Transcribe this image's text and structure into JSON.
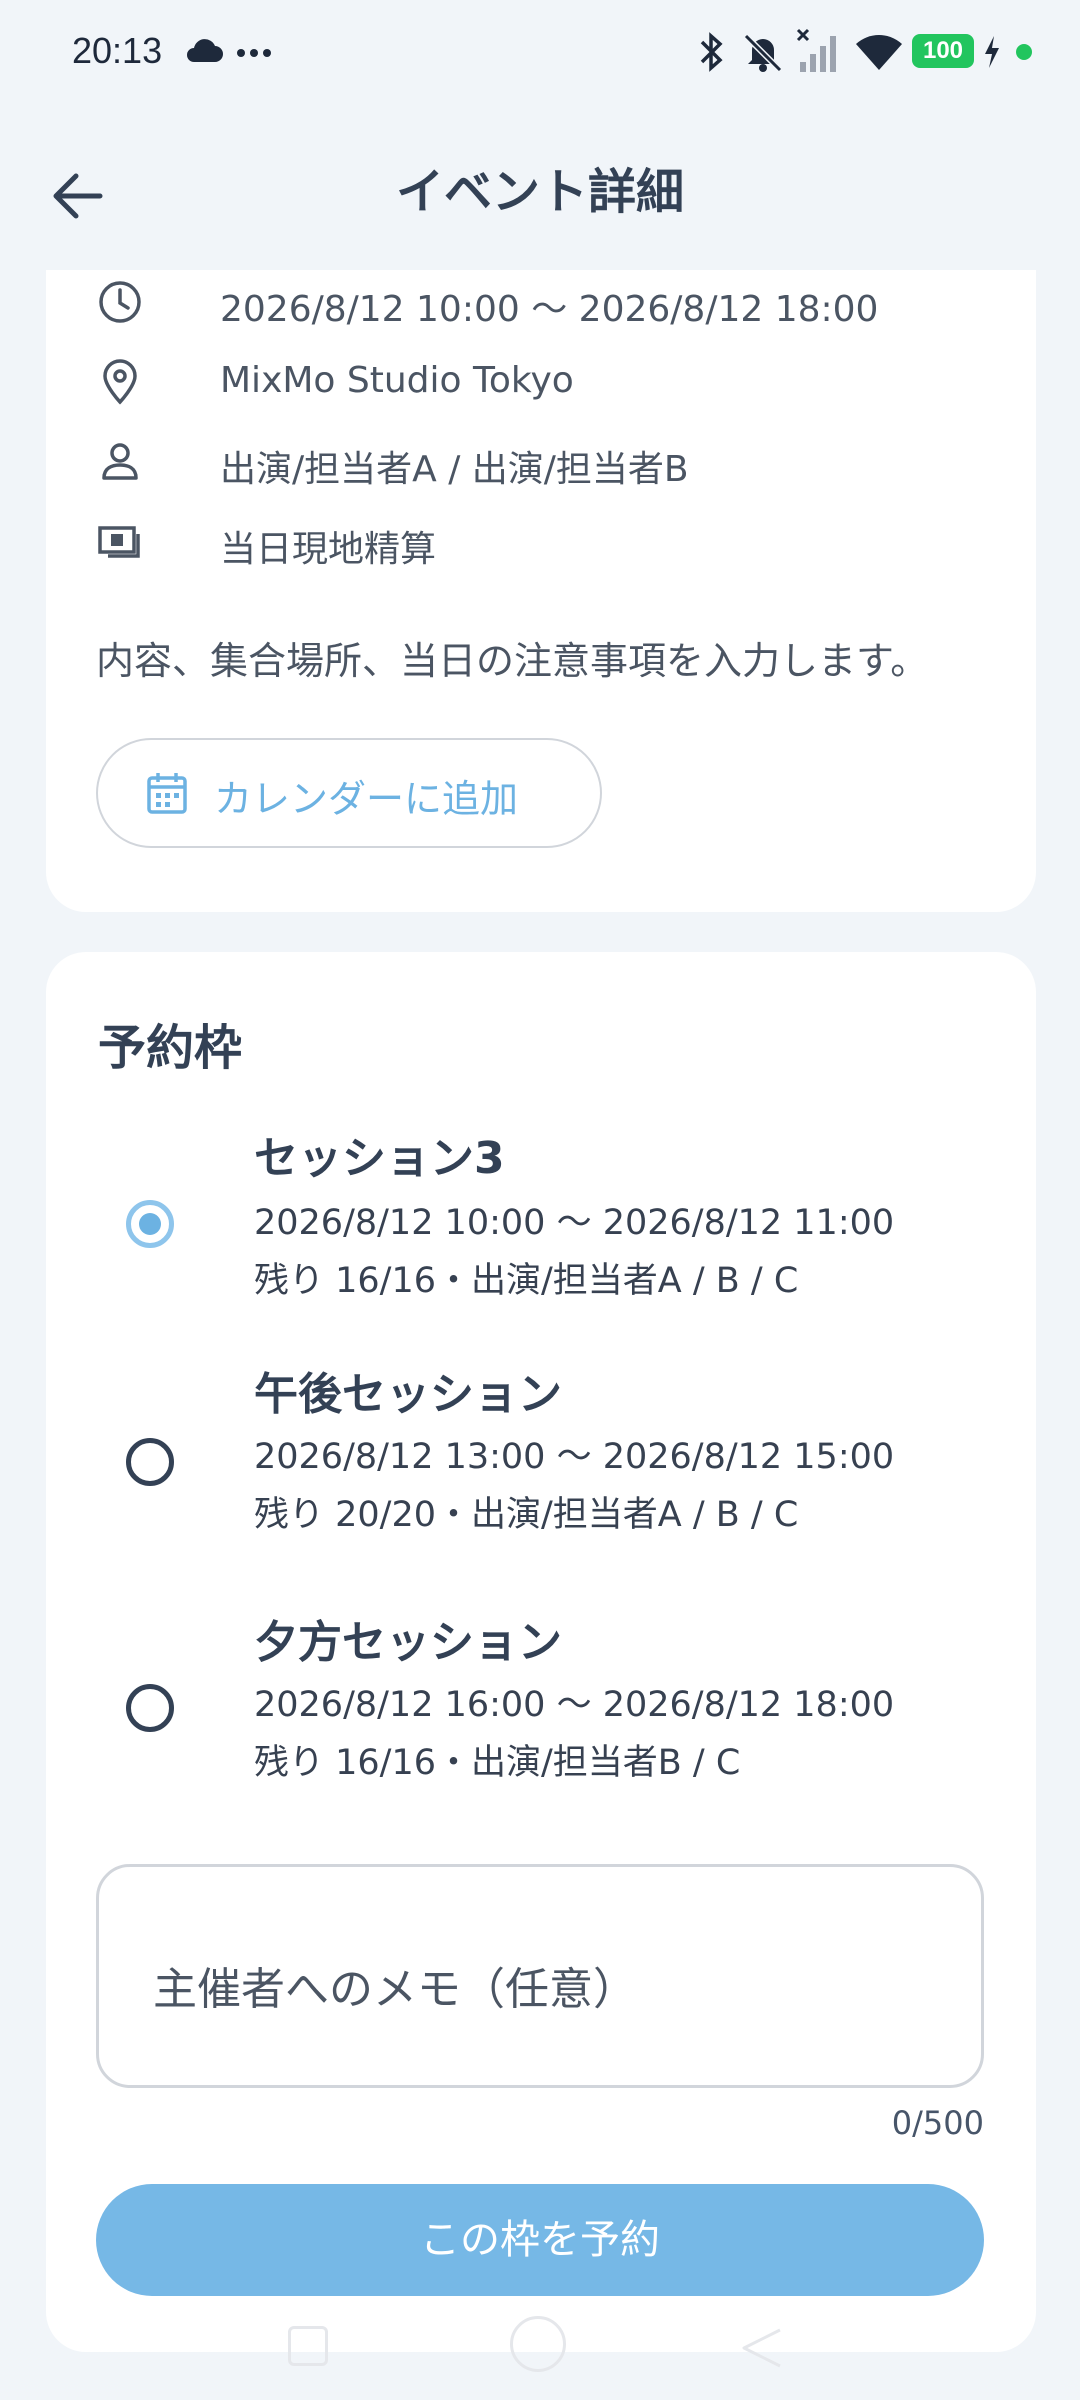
{
  "status_bar": {
    "time": "20:13",
    "battery": "100",
    "icons": [
      "cloud-icon",
      "more-dots-icon",
      "bluetooth-icon",
      "bell-muted-icon",
      "signal-off-icon",
      "wifi-icon",
      "battery-icon",
      "charging-icon",
      "green-dot-icon"
    ]
  },
  "header": {
    "title": "イベント詳細",
    "back_icon": "arrow-left-icon"
  },
  "event": {
    "datetime": "2026/8/12 10:00 〜 2026/8/12 18:00",
    "location": "MixMo Studio Tokyo",
    "performers": "出演/担当者A / 出演/担当者B",
    "payment": "当日現地精算",
    "description": "内容、集合場所、当日の注意事項を入力します。",
    "calendar_button": "カレンダーに追加"
  },
  "booking": {
    "title": "予約枠",
    "slots": [
      {
        "name": "セッション3",
        "time": "2026/8/12 10:00 〜 2026/8/12 11:00",
        "remaining": "残り 16/16・出演/担当者A / B / C",
        "selected": true
      },
      {
        "name": "午後セッション",
        "time": "2026/8/12 13:00 〜 2026/8/12 15:00",
        "remaining": "残り 20/20・出演/担当者A / B / C",
        "selected": false
      },
      {
        "name": "夕方セッション",
        "time": "2026/8/12 16:00 〜 2026/8/12 18:00",
        "remaining": "残り 16/16・出演/担当者B / C",
        "selected": false
      }
    ],
    "memo_placeholder": "主催者へのメモ（任意）",
    "memo_value": "",
    "memo_counter": "0/500",
    "submit_label": "この枠を予約"
  },
  "colors": {
    "accent": "#6cb2e2",
    "button": "#76b8e6",
    "battery": "#22c55e",
    "background": "#f1f5f9"
  }
}
